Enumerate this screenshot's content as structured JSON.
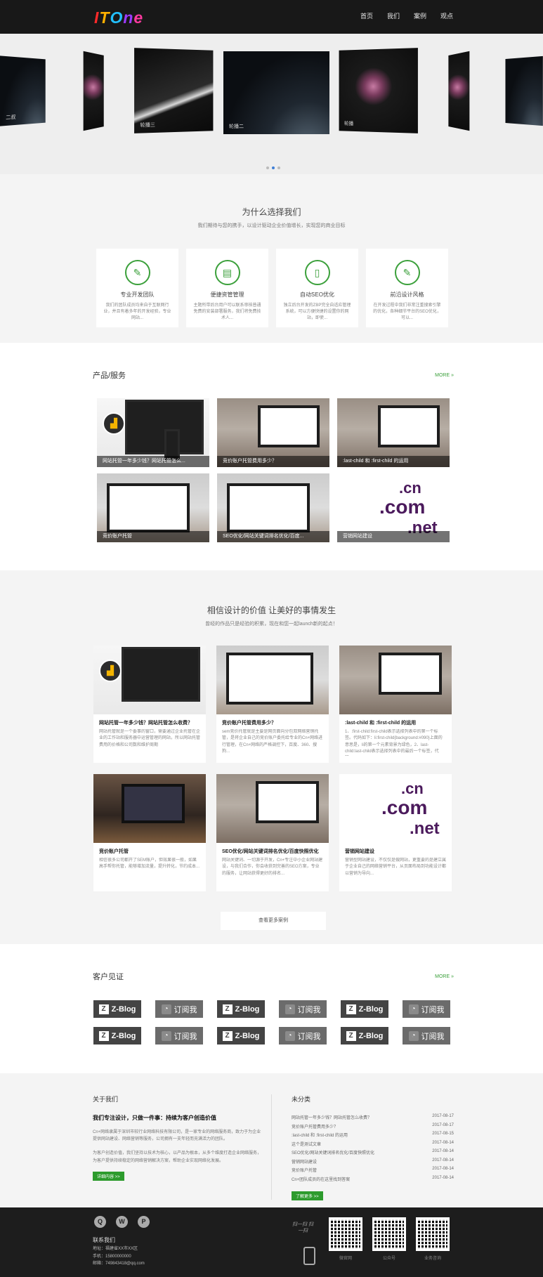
{
  "header": {
    "logo": "ITOne",
    "nav": [
      "首页",
      "我们",
      "案例",
      "观点"
    ]
  },
  "slider": {
    "captions": [
      "二叔",
      "轮播三",
      "轮播二",
      "轮播"
    ],
    "dots_total": 3,
    "dots_active": 1
  },
  "why": {
    "title": "为什么选择我们",
    "subtitle": "我们期待与您的携手，以设计驱动企业价值增长，实现您的商业目标",
    "features": [
      {
        "icon": "edit-icon",
        "glyph": "✎",
        "title": "专业开发团队",
        "desc": "我们的团队成员均来自于互联网行业，并且有着多年的开发经验，专业网站..."
      },
      {
        "icon": "document-icon",
        "glyph": "▤",
        "title": "便捷资管管理",
        "desc": "主题所带后台用户可以联系审核普通免费的安装部署服务，我们将免费技术人..."
      },
      {
        "icon": "phone-icon",
        "glyph": "▯",
        "title": "自动SEO优化",
        "desc": "独立后台开发的ZBP完全自适应管理系统，可以方便快捷的设置你的网站，即使..."
      },
      {
        "icon": "edit-icon",
        "glyph": "✎",
        "title": "前沿设计风格",
        "desc": "在开发过程中我们非常注重搜索引擎的优化，各种细节平台的SEO优化，可以..."
      }
    ]
  },
  "products": {
    "title": "产品/服务",
    "more": "MORE »",
    "items": [
      "网站托管一年多少钱？网站托管怎么...",
      "竞价账户托管费用多少？",
      ":last-child 和 :first-child 的运用",
      "竞价账户托管",
      "SEO优化/网站关键词排名优化/百度...",
      "营销网站建设"
    ]
  },
  "values": {
    "title": "相信设计的价值 让美好的事情发生",
    "subtitle": "曾经的作品只是经验的积累，现在和您一起launch新的起点！",
    "cards": [
      {
        "title": "网站托管一年多少钱？网站托管怎么收费？",
        "desc": "网站托管就是一个委事的窗口，需要通过企业托管在企业的工作站和服务器中运营管理的网站，所以网站托管费用的价格和公司数和维护周期"
      },
      {
        "title": "竞价账户托管费用多少？",
        "desc": "sem竞价托管就是主要是网页面向分包双网络营销托管，是将企业自己的竞价账户委托给专业的Cn+网络进行管理，在Cn+网络的严格调控下，百度、360、搜狗..."
      },
      {
        "title": ":last-child 和 :first-child 的运用",
        "desc": "1、:first-child:first-child表示选择列表中的第一个标签。代码如下：li:first-child{background:#090}上面的意思是，li的第一个元素背景为绿色，2、last-child:last-child表示选择列表中的最后一个标签，代码..."
      },
      {
        "title": "竞价账户托管",
        "desc": "相信很多公司都开了SEM账户，但效果很一般，如果高手帮你托管，能够增加流量，提升转化，节约成本..."
      },
      {
        "title": "SEO优化/网站关键词排名优化/百度快照优化",
        "desc": "网站关键词、一切源于开发，Cn+专注中小企业网站建设，与我们合作，你会收获到完善的SEO方案，专业的服务，让网站获得更好的排名..."
      },
      {
        "title": "营销网站建设",
        "desc": "营销型网站建设，不仅仅是做网站，更重要的是建立属于企业自己的网络营销平台，从页面布局到功能设计都以营销为导向..."
      }
    ],
    "more_button": "查看更多案例"
  },
  "clients": {
    "title": "客户见证",
    "more": "MORE »",
    "logos": [
      "Z-Blog",
      "订阅我",
      "Z-Blog",
      "订阅我",
      "Z-Blog",
      "订阅我",
      "Z-Blog",
      "订阅我",
      "Z-Blog",
      "订阅我",
      "Z-Blog",
      "订阅我"
    ]
  },
  "about": {
    "title": "关于我们",
    "headline": "我们专注设计，只做一件事：持续为客户创造价值",
    "para1": "Cn+网络隶属于深圳市较行业网络科技有限公司，是一家专业的网络服务商，致力于为企业提供网站建设、网络营销等服务，公司拥有一支年轻而充满活力的团队。",
    "para2": "为客户创造价值，我们坚持以技术为核心，以产品为根本，从多个维度打造企业网络服务，为客户提供持续稳定的网络营销解决方案，帮助企业实现网络化发展。",
    "button": "详细内容 >>",
    "news_title": "未分类",
    "news": [
      {
        "title": "网站托管一年多少钱？网站托管怎么收费？",
        "date": "2017-08-17"
      },
      {
        "title": "竞价账户托管费用多少？",
        "date": "2017-08-17"
      },
      {
        "title": ":last-child 和 :first-child 的运用",
        "date": "2017-08-15"
      },
      {
        "title": "这个是测试文章",
        "date": "2017-08-14"
      },
      {
        "title": "SEO优化/网站关键词排名优化/百度快照优化",
        "date": "2017-08-14"
      },
      {
        "title": "营销网站建设",
        "date": "2017-08-14"
      },
      {
        "title": "竞价账户托管",
        "date": "2017-08-14"
      },
      {
        "title": "Cn+团队成员的在这里找到答案",
        "date": "2017-08-14"
      }
    ],
    "news_button": "了解更多 >>"
  },
  "footer": {
    "contact_title": "联系我们",
    "address": "地址：福建省XX市XX区",
    "phone": "手机：15800000000",
    "email": "邮箱：749843418@qq.com",
    "scan_text": "扫一扫 扫一扫",
    "qrcodes": [
      "微官网",
      "公众号",
      "业务咨询"
    ]
  }
}
